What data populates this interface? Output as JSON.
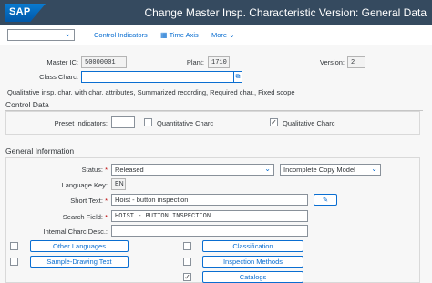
{
  "shell": {
    "logo": "SAP",
    "title": "Change Master Insp. Characteristic Version: General Data"
  },
  "toolbar": {
    "control_indicators": "Control Indicators",
    "time_axis": "Time Axis",
    "more": "More"
  },
  "header": {
    "master_ic_label": "Master IC:",
    "master_ic_value": "50000001",
    "plant_label": "Plant:",
    "plant_value": "1710",
    "version_label": "Version:",
    "version_value": "2",
    "class_charc_label": "Class Charc:",
    "class_charc_value": "",
    "description": "Qualitative insp. char. with char. attributes, Summarized recording, Required char., Fixed scope"
  },
  "control_data": {
    "title": "Control Data",
    "preset_label": "Preset Indicators:",
    "quantitative_label": "Quantitative Charc",
    "quantitative_checked": false,
    "qualitative_label": "Qualitative Charc",
    "qualitative_checked": true
  },
  "general": {
    "title": "General Information",
    "status_label": "Status:",
    "status_value": "Released",
    "copy_model_value": "Incomplete Copy Model",
    "language_label": "Language Key:",
    "language_value": "EN",
    "short_text_label": "Short Text:",
    "short_text_value": "Hoist - button inspection",
    "search_label": "Search Field:",
    "search_value": "HOIST - BUTTON INSPECTION",
    "internal_label": "Internal Charc Desc.:",
    "internal_value": "",
    "buttons": {
      "other_languages": "Other Languages",
      "sample_drawing": "Sample-Drawing Text",
      "classification": "Classification",
      "inspection_methods": "Inspection Methods",
      "catalogs": "Catalogs"
    },
    "checks": {
      "other_languages": false,
      "sample_drawing": false,
      "classification": false,
      "inspection_methods": false,
      "catalogs": true
    }
  }
}
